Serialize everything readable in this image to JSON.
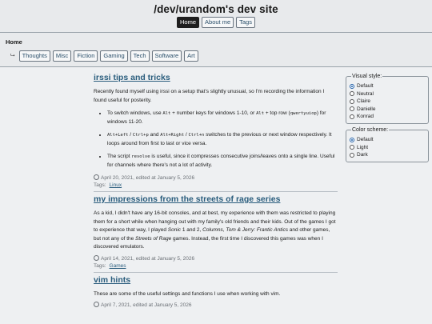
{
  "site": {
    "title": "/dev/urandom's dev site"
  },
  "nav": [
    {
      "label": "Home",
      "active": true
    },
    {
      "label": "About me",
      "active": false
    },
    {
      "label": "Tags",
      "active": false
    }
  ],
  "breadcrumb": {
    "home": "Home",
    "turn_glyph": "⮡"
  },
  "categories": [
    "Thoughts",
    "Misc",
    "Fiction",
    "Gaming",
    "Tech",
    "Software",
    "Art"
  ],
  "posts": [
    {
      "title": "irssi tips and tricks",
      "intro": "Recently found myself using irssi on a setup that's slightly unusual, so I'm recording the information I found useful for posterity.",
      "bullets": [
        [
          "To switch windows, use ",
          "Alt",
          " + number keys for windows 1-10, or ",
          "Alt",
          " + top row (",
          "qwertyuiop",
          ") for windows 11-20."
        ],
        [
          "",
          "Alt+Left",
          " / ",
          "Ctrl+p",
          " and ",
          "Alt+Right",
          " / ",
          "Ctrl+n",
          " switches to the previous or next window respectively. It loops around from first to last or vice versa."
        ],
        [
          "The script ",
          "revolve",
          " is useful, since it compresses consecutive joins/leaves onto a single line. Useful for channels where there's not a lot of activity."
        ]
      ],
      "date": "April 20, 2021, edited at January 5, 2026",
      "tags_label": "Tags:",
      "tag": "Linux"
    },
    {
      "title": "my impressions from the streets of rage series",
      "intro_parts": [
        "As a kid, I didn't have any 16-bit consoles, and at best, my experience with them was restricted to playing them for a short while when hanging out with my family's old friends and their kids. Out of the games I got to experience that way, I played ",
        "Sonic",
        " 1 and 2, ",
        "Columns",
        ", ",
        "Tom & Jerry: Frantic Antics",
        " and other games, but not any of the ",
        "Streets of Rage",
        " games. Instead, the first time I discovered this games was when I discovered emulators."
      ],
      "date": "April 14, 2021, edited at January 5, 2026",
      "tags_label": "Tags:",
      "tag": "Games"
    },
    {
      "title": "vim hints",
      "intro": "These are some of the useful settings and functions I use when working with vim.",
      "date": "April 7, 2021, edited at January 5, 2026"
    }
  ],
  "visual_style": {
    "title": "Visual style:",
    "options": [
      "Default",
      "Neutral",
      "Claire",
      "Danielle",
      "Konrad"
    ],
    "selected": "Default"
  },
  "color_scheme": {
    "title": "Color scheme:",
    "options": [
      "Default",
      "Light",
      "Dark"
    ],
    "selected": "Default"
  }
}
